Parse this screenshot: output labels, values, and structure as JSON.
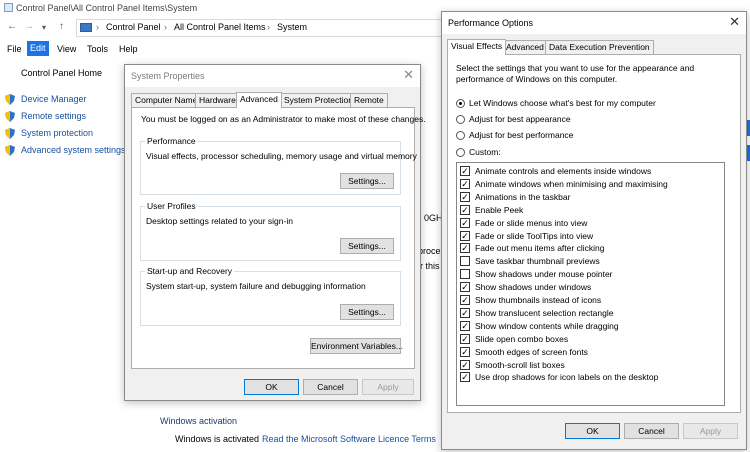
{
  "control_panel": {
    "window_title": "Control Panel\\All Control Panel Items\\System",
    "breadcrumbs": [
      "Control Panel",
      "All Control Panel Items",
      "System"
    ],
    "menu": [
      "File",
      "Edit",
      "View",
      "Tools",
      "Help"
    ],
    "home_link": "Control Panel Home",
    "side_links": [
      "Device Manager",
      "Remote settings",
      "System protection",
      "Advanced system settings"
    ],
    "bg_fragments": [
      "0GHz",
      "proce",
      "r this"
    ],
    "windows_activation_heading": "Windows activation",
    "activation_status": "Windows is activated",
    "licence_link": "Read the Microsoft Software Licence Terms"
  },
  "system_properties": {
    "title": "System Properties",
    "tabs": [
      "Computer Name",
      "Hardware",
      "Advanced",
      "System Protection",
      "Remote"
    ],
    "selected_tab": "Advanced",
    "admin_note": "You must be logged on as an Administrator to make most of these changes.",
    "groups": [
      {
        "title": "Performance",
        "description": "Visual effects, processor scheduling, memory usage and virtual memory",
        "button": "Settings..."
      },
      {
        "title": "User Profiles",
        "description": "Desktop settings related to your sign-in",
        "button": "Settings..."
      },
      {
        "title": "Start-up and Recovery",
        "description": "System start-up, system failure and debugging information",
        "button": "Settings..."
      }
    ],
    "env_button": "Environment Variables...",
    "ok": "OK",
    "cancel": "Cancel",
    "apply": "Apply"
  },
  "performance_options": {
    "title": "Performance Options",
    "tabs": [
      "Visual Effects",
      "Advanced",
      "Data Execution Prevention"
    ],
    "selected_tab": "Visual Effects",
    "intro": [
      "Select the settings that you want to use for the appearance and",
      "performance of Windows on this computer."
    ],
    "radios": [
      {
        "label": "Let Windows choose what's best for my computer",
        "checked": true
      },
      {
        "label": "Adjust for best appearance",
        "checked": false
      },
      {
        "label": "Adjust for best performance",
        "checked": false
      },
      {
        "label": "Custom:",
        "checked": false
      }
    ],
    "effects": [
      {
        "label": "Animate controls and elements inside windows",
        "checked": true
      },
      {
        "label": "Animate windows when minimising and maximising",
        "checked": true
      },
      {
        "label": "Animations in the taskbar",
        "checked": true
      },
      {
        "label": "Enable Peek",
        "checked": true
      },
      {
        "label": "Fade or slide menus into view",
        "checked": true
      },
      {
        "label": "Fade or slide ToolTips into view",
        "checked": true
      },
      {
        "label": "Fade out menu items after clicking",
        "checked": true
      },
      {
        "label": "Save taskbar thumbnail previews",
        "checked": false
      },
      {
        "label": "Show shadows under mouse pointer",
        "checked": false
      },
      {
        "label": "Show shadows under windows",
        "checked": true
      },
      {
        "label": "Show thumbnails instead of icons",
        "checked": true
      },
      {
        "label": "Show translucent selection rectangle",
        "checked": true
      },
      {
        "label": "Show window contents while dragging",
        "checked": true
      },
      {
        "label": "Slide open combo boxes",
        "checked": true
      },
      {
        "label": "Smooth edges of screen fonts",
        "checked": true
      },
      {
        "label": "Smooth-scroll list boxes",
        "checked": true
      },
      {
        "label": "Use drop shadows for icon labels on the desktop",
        "checked": true
      }
    ],
    "ok": "OK",
    "cancel": "Cancel",
    "apply": "Apply"
  },
  "icons": {
    "close": "close-icon",
    "shield": "uac-shield-icon",
    "back": "back-arrow-icon",
    "forward": "forward-arrow-icon",
    "up": "up-arrow-icon",
    "checkmark": "✓"
  },
  "colors": {
    "accent": "#1a73e8",
    "link": "#1a4fa0",
    "dialog_bg": "#f0f0f0"
  }
}
